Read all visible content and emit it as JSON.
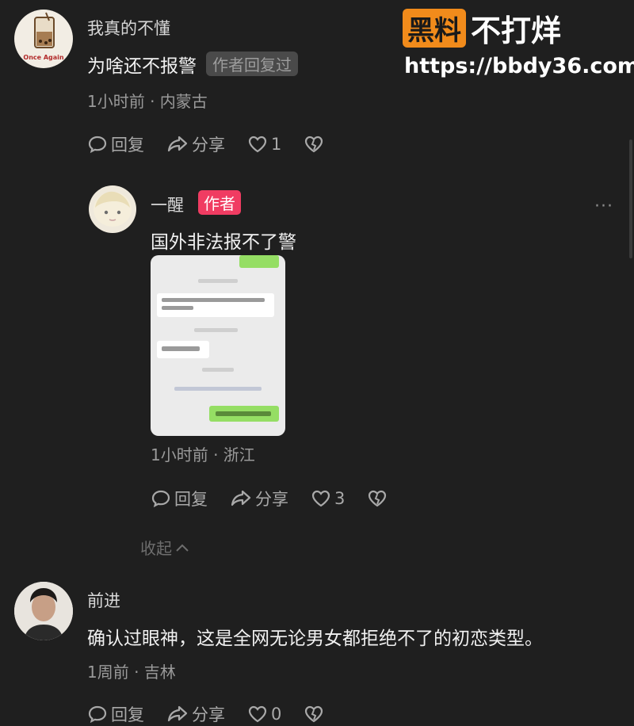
{
  "watermark": {
    "badge": "黑料",
    "slogan": "不打烊",
    "url": "https://bbdy36.com"
  },
  "comments": [
    {
      "user": "我真的不懂",
      "avatar_text": "Once Again",
      "text": "为啥还不报警",
      "badge": "作者回复过",
      "meta": "1小时前 · 内蒙古",
      "reply_label": "回复",
      "share_label": "分享",
      "likes": "1"
    },
    {
      "user": "一醒",
      "badge": "作者",
      "text": "国外非法报不了警",
      "meta": "1小时前 · 浙江",
      "reply_label": "回复",
      "share_label": "分享",
      "likes": "3",
      "more": "···"
    },
    {
      "user": "前进",
      "text": "确认过眼神，这是全网无论男女都拒绝不了的初恋类型。",
      "meta": "1周前 · 吉林",
      "reply_label": "回复",
      "share_label": "分享",
      "likes": "0"
    }
  ],
  "collapse_label": "收起"
}
